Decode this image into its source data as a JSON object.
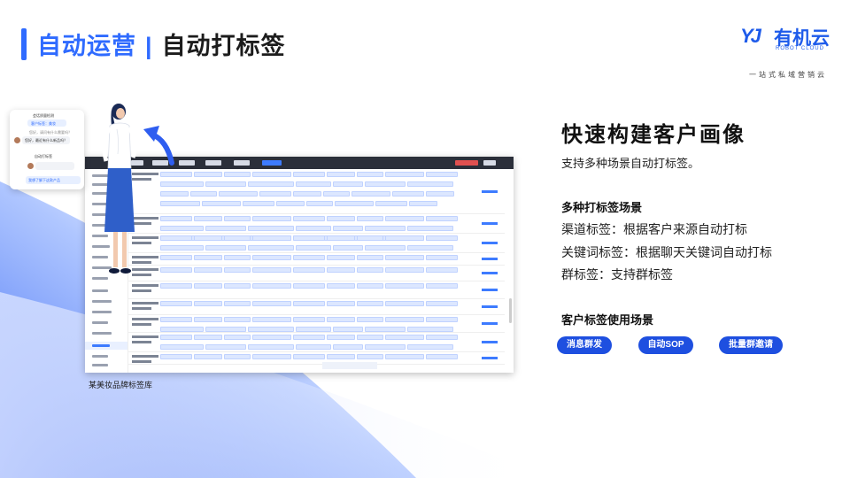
{
  "header": {
    "title_main": "自动运营",
    "title_sep": "|",
    "title_sub": "自动打标签"
  },
  "logo": {
    "mark": "YJ",
    "name_cn": "有机云",
    "name_en": "ROBOT CLOUD",
    "slogan": "一站式私域营销云"
  },
  "caption": "某美妆品牌标签库",
  "chat": {
    "line1": "会话质量检测",
    "line2": "客户标签：美妆",
    "line3": "您好，请问有什么需要吗？",
    "line4": "自动打标签",
    "line5": "您好，最近有什么新品吗？",
    "line6": "我想了解下这款产品"
  },
  "right": {
    "heading": "快速构建客户画像",
    "subtitle": "支持多种场景自动打标签。",
    "section1_title": "多种打标签场景",
    "lines": [
      "渠道标签：根据客户来源自动打标",
      "关键词标签：根据聊天关键词自动打标",
      "群标签：支持群标签"
    ],
    "section2_title": "客户标签使用场景",
    "pills": [
      "消息群发",
      "自动SOP",
      "批量群邀请"
    ]
  },
  "colors": {
    "brand": "#2f6bff",
    "pill": "#1e4fe0",
    "tag_bg": "#dce7ff"
  }
}
